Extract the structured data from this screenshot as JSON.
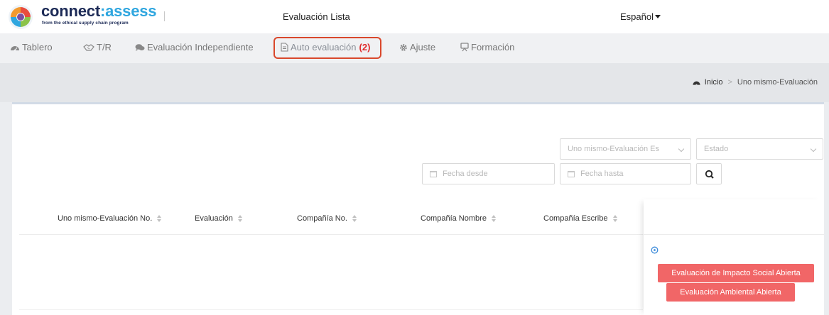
{
  "app": {
    "logo": {
      "name": "connect",
      "separator": ":",
      "accent": "assess",
      "tagline": "from the ethical supply chain program"
    },
    "page_title": "Evaluación Lista",
    "language": "Español"
  },
  "nav": {
    "items": [
      {
        "label": "Tablero",
        "icon": "dashboard-icon"
      },
      {
        "label": "T/R",
        "icon": "handshake-icon"
      },
      {
        "label": "Evaluación Independiente",
        "icon": "chat-icon"
      },
      {
        "label": "Auto evaluación",
        "badge": "(2)",
        "icon": "document-icon"
      },
      {
        "label": "Ajuste",
        "icon": "gear-icon"
      },
      {
        "label": "Formación",
        "icon": "training-icon"
      }
    ]
  },
  "breadcrumb": {
    "home": "Inicio",
    "separator": ">",
    "current": "Uno mismo-Evaluación"
  },
  "filters": {
    "type_select": "Uno mismo-Evaluación Es",
    "status_select": "Estado",
    "date_from_placeholder": "Fecha desde",
    "date_to_placeholder": "Fecha hasta"
  },
  "table": {
    "columns": [
      "Uno mismo-Evaluación No.",
      "Evaluación",
      "Compañía No.",
      "Compañía Nombre",
      "Compañía Escribe"
    ]
  },
  "actions": {
    "social": "Evaluación de Impacto Social Abierta",
    "environmental": "Evaluación Ambiental Abierta"
  },
  "colors": {
    "brand_navy": "#1c2a56",
    "brand_blue": "#2fa6df",
    "action_red": "#f16667",
    "highlight": "#d9472b",
    "badge_red": "#e02b2b"
  }
}
